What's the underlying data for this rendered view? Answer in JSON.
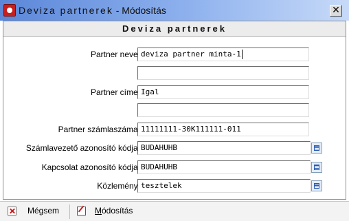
{
  "window": {
    "title_a": "Deviza partnerek",
    "title_b": " - Módosítás",
    "close_glyph": "✕"
  },
  "form": {
    "header": "Deviza partnerek",
    "partner_name_label": "Partner neve:",
    "partner_name": "deviza partner minta-1",
    "partner_name_2": "",
    "partner_address_label": "Partner címe:",
    "partner_address": "Igal",
    "partner_address_2": "",
    "account_number_label": "Partner számlaszáma:",
    "account_number": "11111111-30K111111-011",
    "account_manager_id_label": "Számlavezető azonosító kódja:",
    "account_manager_id": "BUDAHUHB",
    "correspondent_id_label": "Kapcsolat azonosító kódja:",
    "correspondent_id": "BUDAHUHB",
    "notice_label": "Közlemény:",
    "notice": "tesztelek"
  },
  "toolbar": {
    "cancel_pre": "Mé",
    "cancel_u": "g",
    "cancel_post": "sem",
    "modify_u": "M",
    "modify_post": "ódosítás"
  },
  "icons": {
    "app": "app-logo-icon",
    "close": "close-icon",
    "lookup": "lookup-icon",
    "cancel": "cancel-x-icon",
    "modify": "edit-icon"
  }
}
